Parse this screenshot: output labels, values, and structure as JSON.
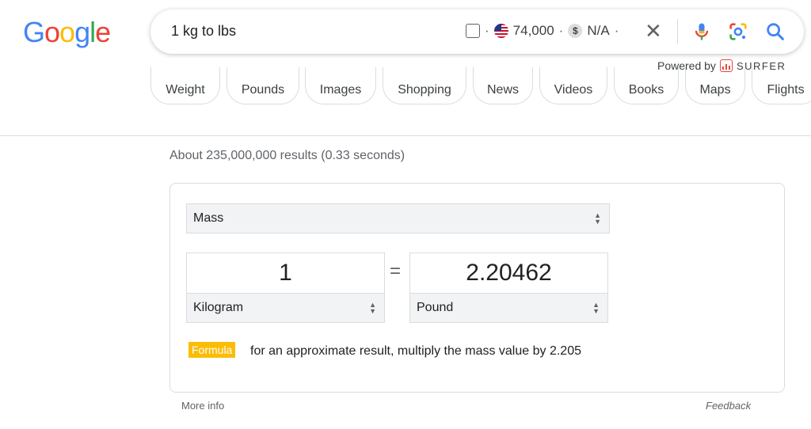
{
  "logo": {
    "letters": [
      "G",
      "o",
      "o",
      "g",
      "l",
      "e"
    ],
    "colors": [
      "#4285F4",
      "#EA4335",
      "#FBBC05",
      "#4285F4",
      "#34A853",
      "#EA4335"
    ]
  },
  "search": {
    "query": "1 kg to lbs",
    "extension": {
      "volume": "74,000",
      "cpc": "N/A",
      "separator": "·"
    },
    "clear_icon": "close-icon",
    "icons": [
      "microphone-icon",
      "google-lens-icon",
      "search-icon"
    ]
  },
  "powered_by": {
    "label": "Powered by",
    "brand": "SURFER"
  },
  "chips": [
    "Weight",
    "Pounds",
    "Images",
    "Shopping",
    "News",
    "Videos",
    "Books",
    "Maps",
    "Flights"
  ],
  "stats": "About 235,000,000 results (0.33 seconds)",
  "converter": {
    "category": "Mass",
    "from_value": "1",
    "from_unit": "Kilogram",
    "equals": "=",
    "to_value": "2.20462",
    "to_unit": "Pound",
    "formula_tag": "Formula",
    "formula_text": "for an approximate result, multiply the mass value by 2.205"
  },
  "footer": {
    "more_info": "More info",
    "feedback": "Feedback"
  }
}
